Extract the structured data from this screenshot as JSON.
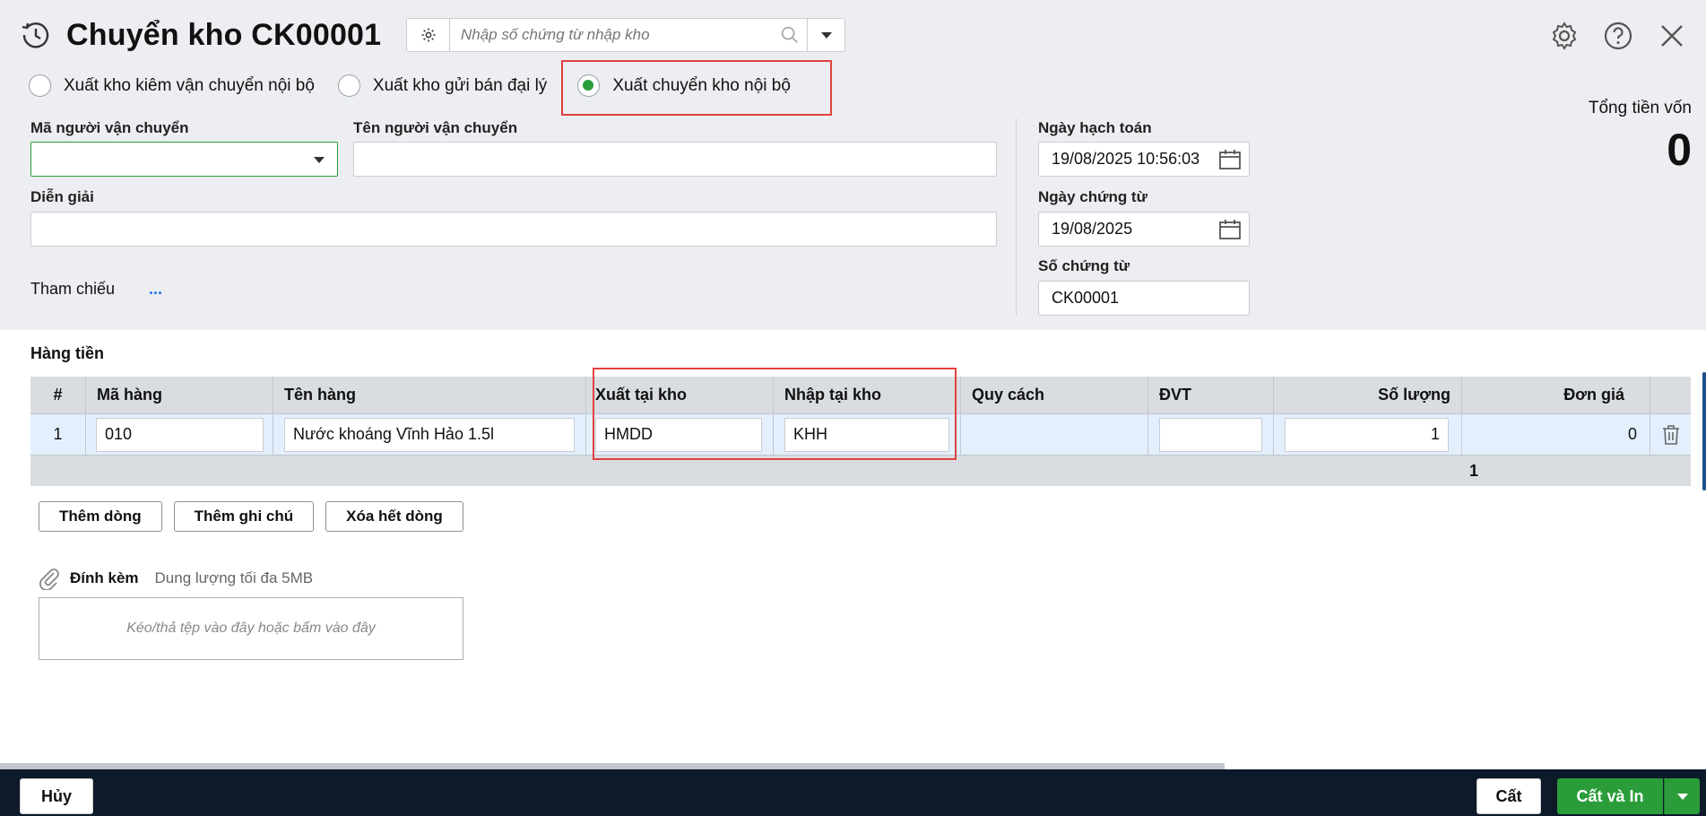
{
  "header": {
    "title": "Chuyển kho CK00001",
    "search_placeholder": "Nhập số chứng từ nhập kho"
  },
  "radios": [
    {
      "label": "Xuất kho kiêm vận chuyển nội bộ",
      "selected": false
    },
    {
      "label": "Xuất kho gửi bán đại lý",
      "selected": false
    },
    {
      "label": "Xuất chuyển kho nội bộ",
      "selected": true
    }
  ],
  "form": {
    "ma_nguoi_vc_label": "Mã người vận chuyển",
    "ma_nguoi_vc_value": "",
    "ten_nguoi_vc_label": "Tên người vận chuyển",
    "ten_nguoi_vc_value": "",
    "dien_giai_label": "Diễn giải",
    "dien_giai_value": "",
    "tham_chieu_label": "Tham chiếu",
    "tham_chieu_link": "...",
    "ngay_hach_toan_label": "Ngày hạch toán",
    "ngay_hach_toan_value": "19/08/2025 10:56:03",
    "ngay_chung_tu_label": "Ngày chứng từ",
    "ngay_chung_tu_value": "19/08/2025",
    "so_chung_tu_label": "Số chứng từ",
    "so_chung_tu_value": "CK00001",
    "tong_tien_label": "Tổng tiền vốn",
    "tong_tien_value": "0"
  },
  "grid": {
    "section_title": "Hàng tiền",
    "columns": [
      "#",
      "Mã hàng",
      "Tên hàng",
      "Xuất tại kho",
      "Nhập tại kho",
      "Quy cách",
      "ĐVT",
      "Số lượng",
      "Đơn giá"
    ],
    "rows": [
      {
        "no": "1",
        "ma_hang": "010",
        "ten_hang": "Nước khoáng Vĩnh Hảo 1.5l",
        "xuat_kho": "HMDD",
        "nhap_kho": "KHH",
        "quy_cach": "",
        "dvt": "",
        "so_luong": "1",
        "don_gia": "0"
      }
    ],
    "total_so_luong": "1"
  },
  "actions": {
    "add_row": "Thêm dòng",
    "add_note": "Thêm ghi chú",
    "delete_all": "Xóa hết dòng"
  },
  "attachment": {
    "title": "Đính kèm",
    "limit": "Dung lượng tối đa 5MB",
    "drop_text": "Kéo/thả tệp vào đây hoặc bấm vào đây"
  },
  "footer": {
    "cancel": "Hủy",
    "save": "Cất",
    "save_print": "Cất và In"
  },
  "colors": {
    "highlight": "#e0423d",
    "primary_green": "#2a9d3a",
    "footer_bg": "#0d1a2a"
  }
}
